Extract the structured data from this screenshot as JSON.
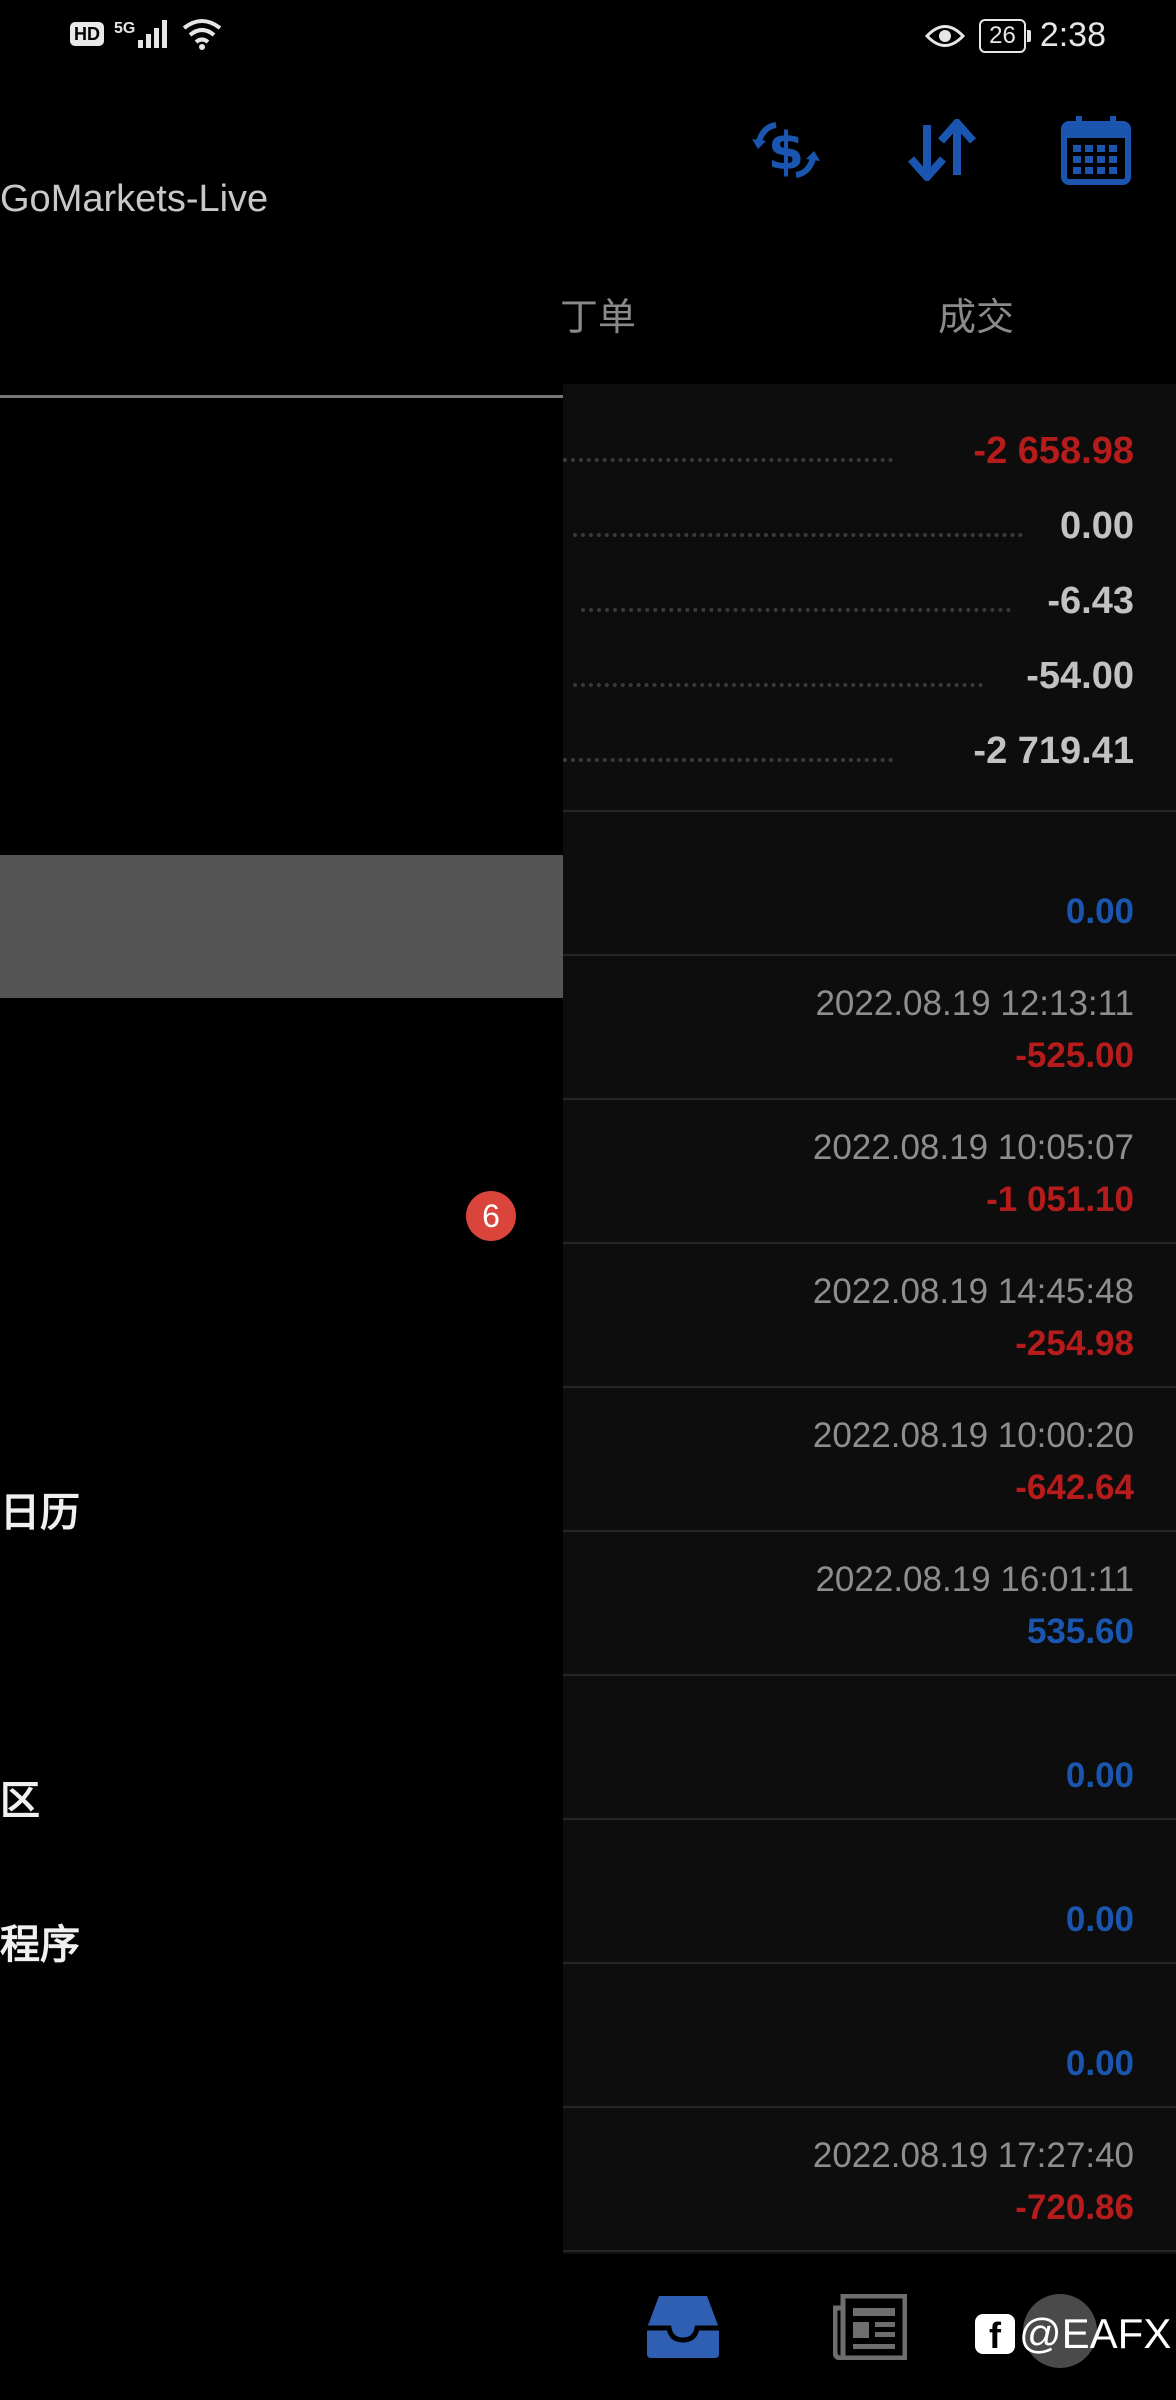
{
  "status_bar": {
    "left_icons": [
      "hd-icon",
      "5g-signal-icon",
      "wifi-icon"
    ],
    "hd": "HD",
    "net": "5G",
    "battery": "26",
    "time": "2:38"
  },
  "header": {
    "account": "GoMarkets-Live",
    "icons": [
      "currency-exchange-icon",
      "sort-icon",
      "calendar-icon"
    ]
  },
  "tabs": {
    "orders": "丁单",
    "deals": "成交"
  },
  "summary": [
    {
      "value": "-2 658.98",
      "color": "red"
    },
    {
      "value": "0.00",
      "color": "grey"
    },
    {
      "value": "-6.43",
      "color": "grey"
    },
    {
      "value": "-54.00",
      "color": "grey"
    },
    {
      "value": "-2 719.41",
      "color": "grey"
    }
  ],
  "deals": [
    {
      "time": "",
      "value": "0.00",
      "color": "blue"
    },
    {
      "time": "2022.08.19 12:13:11",
      "value": "-525.00",
      "color": "red"
    },
    {
      "time": "2022.08.19 10:05:07",
      "value": "-1 051.10",
      "color": "red"
    },
    {
      "time": "2022.08.19 14:45:48",
      "value": "-254.98",
      "color": "red"
    },
    {
      "time": "2022.08.19 10:00:20",
      "value": "-642.64",
      "color": "red"
    },
    {
      "time": "2022.08.19 16:01:11",
      "value": "535.60",
      "color": "blue"
    },
    {
      "time": "",
      "value": "0.00",
      "color": "blue"
    },
    {
      "time": "",
      "value": "0.00",
      "color": "blue"
    },
    {
      "time": "",
      "value": "0.00",
      "color": "blue"
    },
    {
      "time": "2022.08.19 17:27:40",
      "value": "-720.86",
      "color": "red"
    }
  ],
  "drawer": {
    "badge": "6",
    "items": {
      "calendar": "日历",
      "community": "区",
      "apps": "程序"
    }
  },
  "bottom_nav": {
    "icons": [
      "trade-inbox-icon",
      "news-icon",
      "chat-icon"
    ]
  },
  "watermark": {
    "logo": "f",
    "text": "@EAFX"
  },
  "colors": {
    "accent": "#1a56b0",
    "loss": "#b71c1c",
    "badge": "#d9453b"
  }
}
